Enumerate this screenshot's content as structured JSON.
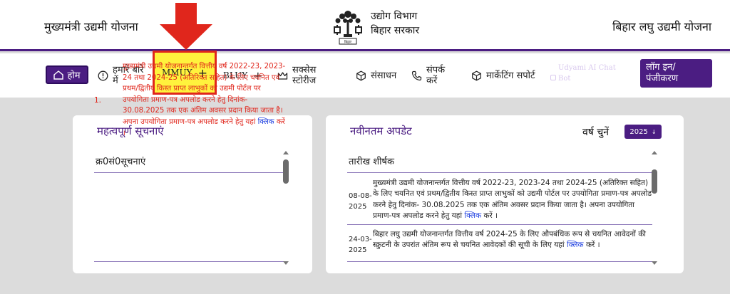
{
  "header": {
    "left_title": "मुख्यमंत्री उद्यमी योजना",
    "dept_line1": "उद्योग विभाग",
    "dept_line2": "बिहार सरकार",
    "right_title": "बिहार लघु उद्यमी योजना",
    "emblem_caption": "बिहार"
  },
  "nav": {
    "home": "होम",
    "about": "हमारे बारे में",
    "mmuy": "MMUY",
    "bluy": "BLUY",
    "success": "सक्सेस स्टोरीज",
    "resources": "संसाधन",
    "contact": "संपर्क करें",
    "marketing": "मार्केटिंग सपोर्ट",
    "chatbot": "Udyami AI Chat Bot",
    "login": "लॉग इन/ पंजीकरण"
  },
  "notices": {
    "title": "महत्वपूर्ण सूचनाएं",
    "column_header": "क्र0सं0सूचनाएं",
    "items": [
      {
        "sno": "1.",
        "text": "मुख्यमंत्री उद्यमी योजनान्तर्गत वित्तीय वर्ष 2022-23, 2023-24 तथा 2024-25 (अतिरिक्त सहित) के लिए चयनित एवं प्रथम/द्वितीय किस्त प्राप्त लाभुकों को उद्यमी पोर्टल पर उपयोगिता प्रमाण-पत्र अपलोड करने हेतु दिनांक- 30.08.2025 तक एक अंतिम अवसर प्रदान किया जाता है। अपना उपयोगिता प्रमाण-पत्र अपलोड करने हेतु यहां",
        "link": "क्लिक",
        "suffix": "करें ।"
      }
    ]
  },
  "updates": {
    "title": "नवीनतम अपडेट",
    "year_label": "वर्ष चुनें",
    "year_value": "2025",
    "column_header": "तारीख शीर्षक",
    "items": [
      {
        "date": "08-08-2025",
        "text": "मुख्यमंत्री उद्यमी योजनान्तर्गत वित्तीय वर्ष 2022-23, 2023-24 तथा 2024-25 (अतिरिक्त सहित) के लिए चयनित एवं प्रथम/द्वितीय किस्त प्राप्त लाभुकों को उद्यमी पोर्टल पर उपयोगिता प्रमाण-पत्र अपलोड करने हेतु दिनांक- 30.08.2025 तक एक अंतिम अवसर प्रदान किया जाता है। अपना उपयोगिता प्रमाण-पत्र अपलोड करने हेतु यहां",
        "link": "क्लिक",
        "suffix": "करें ।"
      },
      {
        "date": "24-03-2025",
        "text": "बिहार लघु उद्यमी योजनान्तर्गत वित्तीय वर्ष 2024-25 के लिए औपबंधिक रूप से चयनित आवेदनों की स्क्रुटनी के उपरांत अंतिम रूप से चयनित आवेदकों की सूची के लिए यहां",
        "link": "क्लिक",
        "suffix": "करें ।"
      }
    ]
  },
  "colors": {
    "brand_purple": "#4b1d82",
    "highlight_yellow": "#fff23d",
    "annotation_red": "#e0261c",
    "link_blue": "#1c3ee0"
  }
}
